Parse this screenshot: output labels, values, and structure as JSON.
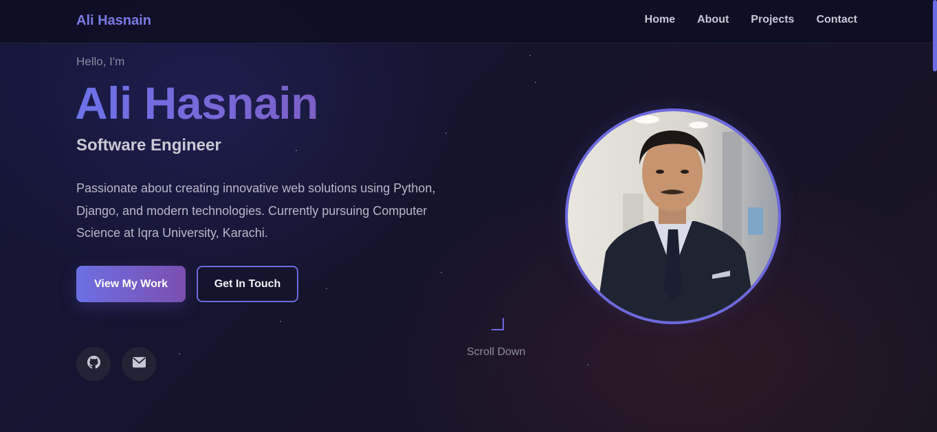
{
  "nav": {
    "brand": "Ali Hasnain",
    "links": [
      "Home",
      "About",
      "Projects",
      "Contact"
    ]
  },
  "hero": {
    "greeting": "Hello, I'm",
    "name": "Ali Hasnain",
    "role": "Software Engineer",
    "description": "Passionate about creating innovative web solutions using Python, Django, and modern technologies. Currently pursuing Computer Science at Iqra University, Karachi.",
    "primary_button": "View My Work",
    "secondary_button": "Get In Touch",
    "scroll_label": "Scroll Down"
  },
  "social": [
    {
      "icon": "github-icon"
    },
    {
      "icon": "envelope-icon"
    }
  ],
  "colors": {
    "accent": "#6c6be0",
    "accent_end": "#7c4fb0",
    "background": "#15163a"
  }
}
